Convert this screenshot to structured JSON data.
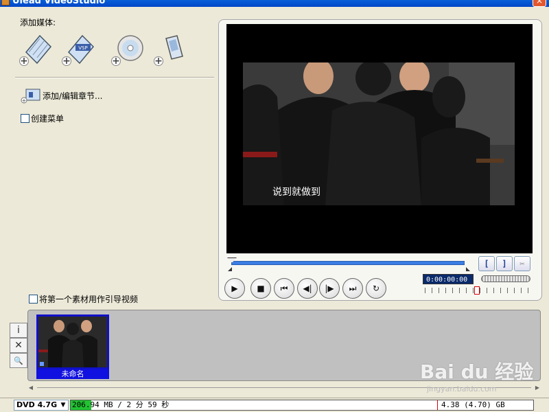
{
  "window": {
    "title": "Ulead VideoStudio",
    "close_glyph": "×"
  },
  "left_panel": {
    "add_media_label": "添加媒体:",
    "media_buttons": [
      {
        "icon": "add-video-icon"
      },
      {
        "icon": "add-vsp-project-icon",
        "badge": "VSP"
      },
      {
        "icon": "add-disc-icon"
      },
      {
        "icon": "add-mobile-device-icon"
      }
    ],
    "chapter_label": "添加/编辑章节...",
    "create_menu_label": "创建菜单",
    "create_menu_checked": false,
    "intro_video_label": "将第一个素材用作引导视频",
    "intro_video_checked": false
  },
  "preview": {
    "subtitle": "说到就做到",
    "mark_in": "[",
    "mark_out": "]",
    "cut_glyph": "✂",
    "timecode": "0:00:00:00",
    "controls": {
      "play": "▶",
      "stop": "■",
      "home": "⏮",
      "prev_frame": "◀|",
      "next_frame": "|▶",
      "end": "⏭",
      "loop": "↻"
    }
  },
  "storyboard": {
    "tools": [
      {
        "glyph": "i"
      },
      {
        "glyph": "✕"
      },
      {
        "glyph": "🔍"
      }
    ],
    "clips": [
      {
        "name": "未命名"
      }
    ]
  },
  "watermark": {
    "logo": "Bai du 经验",
    "url": "jingyan.baidu.com"
  },
  "status": {
    "disc": "DVD 4.7G",
    "used": "206.94 MB /  2 分 59 秒",
    "capacity": "4.38 (4.70) GB",
    "fill_fraction": 0.045
  },
  "colors": {
    "accent": "#0046c8",
    "timeline_fill": "#22c232",
    "clip_border": "#1010c8"
  }
}
